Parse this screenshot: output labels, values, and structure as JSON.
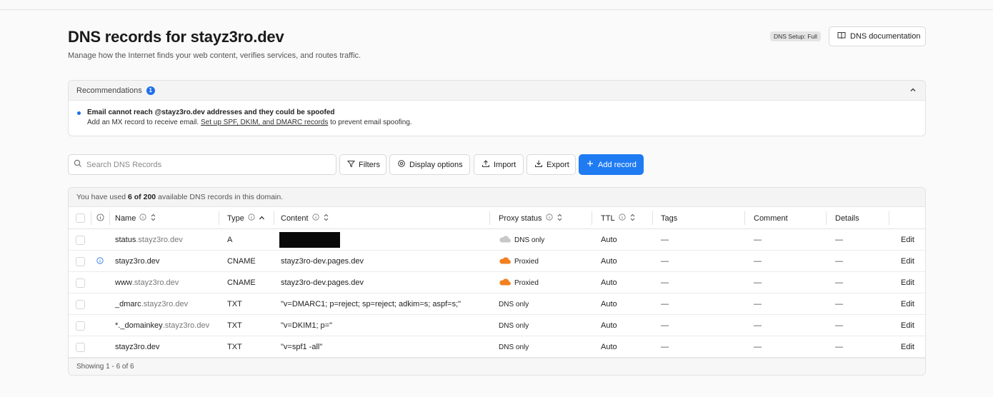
{
  "header": {
    "title": "DNS records for stayz3ro.dev",
    "subtitle": "Manage how the Internet finds your web content, verifies services, and routes traffic.",
    "setup_badge": "DNS Setup: Full",
    "doc_button": "DNS documentation"
  },
  "recommendations": {
    "label": "Recommendations",
    "count": "1",
    "title": "Email cannot reach @stayz3ro.dev addresses and they could be spoofed",
    "body_prefix": "Add an MX record to receive email. ",
    "link": "Set up SPF, DKIM, and DMARC records",
    "body_suffix": " to prevent email spoofing."
  },
  "toolbar": {
    "search_placeholder": "Search DNS Records",
    "filters": "Filters",
    "display_options": "Display options",
    "import": "Import",
    "export": "Export",
    "add_record": "Add record"
  },
  "usage": {
    "prefix": "You have used ",
    "used": "6 of 200",
    "suffix": " available DNS records in this domain."
  },
  "columns": {
    "name": "Name",
    "type": "Type",
    "content": "Content",
    "proxy": "Proxy status",
    "ttl": "TTL",
    "tags": "Tags",
    "comment": "Comment",
    "details": "Details"
  },
  "records": [
    {
      "name_main": "status",
      "name_sub": ".stayz3ro.dev",
      "type": "A",
      "content": "",
      "redacted": true,
      "proxy": "DNS only",
      "proxy_icon": "cloud-gray",
      "ttl": "Auto",
      "tags": "—",
      "comment": "—",
      "details": "—",
      "edit": "Edit"
    },
    {
      "name_main": "stayz3ro.dev",
      "name_sub": "",
      "type": "CNAME",
      "content": "stayz3ro-dev.pages.dev",
      "redacted": false,
      "proxy": "Proxied",
      "proxy_icon": "cloud-orange",
      "ttl": "Auto",
      "tags": "—",
      "comment": "—",
      "details": "—",
      "edit": "Edit",
      "info": true
    },
    {
      "name_main": "www",
      "name_sub": ".stayz3ro.dev",
      "type": "CNAME",
      "content": "stayz3ro-dev.pages.dev",
      "redacted": false,
      "proxy": "Proxied",
      "proxy_icon": "cloud-orange",
      "ttl": "Auto",
      "tags": "—",
      "comment": "—",
      "details": "—",
      "edit": "Edit"
    },
    {
      "name_main": "_dmarc",
      "name_sub": ".stayz3ro.dev",
      "type": "TXT",
      "content": "\"v=DMARC1; p=reject; sp=reject; adkim=s; aspf=s;\"",
      "redacted": false,
      "proxy": "DNS only",
      "proxy_icon": "",
      "ttl": "Auto",
      "tags": "—",
      "comment": "—",
      "details": "—",
      "edit": "Edit"
    },
    {
      "name_main": "*._domainkey",
      "name_sub": ".stayz3ro.dev",
      "type": "TXT",
      "content": "\"v=DKIM1; p=\"",
      "redacted": false,
      "proxy": "DNS only",
      "proxy_icon": "",
      "ttl": "Auto",
      "tags": "—",
      "comment": "—",
      "details": "—",
      "edit": "Edit"
    },
    {
      "name_main": "stayz3ro.dev",
      "name_sub": "",
      "type": "TXT",
      "content": "\"v=spf1 -all\"",
      "redacted": false,
      "proxy": "DNS only",
      "proxy_icon": "",
      "ttl": "Auto",
      "tags": "—",
      "comment": "—",
      "details": "—",
      "edit": "Edit"
    }
  ],
  "footer": {
    "showing": "Showing 1 - 6 of 6"
  },
  "colors": {
    "accent": "#1f7bf2",
    "proxied": "#f38020",
    "dns_only_cloud": "#c8c8c8"
  }
}
